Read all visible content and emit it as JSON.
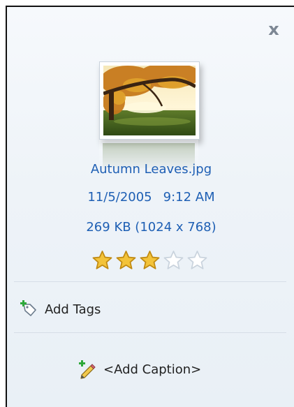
{
  "close": {
    "icon": "close-icon",
    "symbol": "x"
  },
  "file": {
    "name": "Autumn Leaves.jpg",
    "date": "11/5/2005",
    "time": "9:12 AM",
    "size": "269 KB (1024 x 768)"
  },
  "rating": {
    "value": 3,
    "max": 5,
    "filled_color": "#f3c33a",
    "empty_color": "#c9d3dd"
  },
  "tags": {
    "label": "Add Tags",
    "icon": "tag-add-icon"
  },
  "caption": {
    "label": "<Add Caption>",
    "icon": "pencil-add-icon"
  },
  "colors": {
    "accent_text": "#1e5fb4",
    "background": "#eef3f8"
  }
}
